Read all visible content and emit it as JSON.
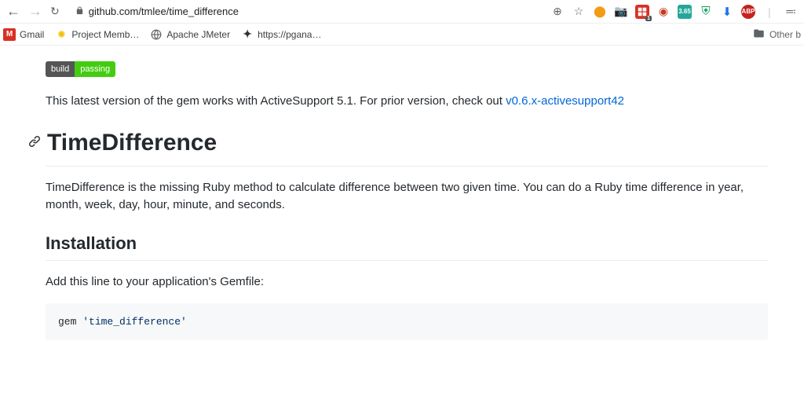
{
  "browser": {
    "url": "github.com/tmlee/time_difference",
    "extensions": {
      "red1_text": "1",
      "teal_text": "3.65",
      "abp_text": "ABP"
    }
  },
  "bookmarks": {
    "gmail": "Gmail",
    "project": "Project Memb…",
    "apache": "Apache JMeter",
    "pgana": "https://pgana…",
    "other": "Other b"
  },
  "badge": {
    "label": "build",
    "status": "passing"
  },
  "readme": {
    "intro_prefix": "This latest version of the gem works with ActiveSupport 5.1. For prior version, check out ",
    "intro_link": "v0.6.x-activesupport42",
    "h1": "TimeDifference",
    "description": "TimeDifference is the missing Ruby method to calculate difference between two given time. You can do a Ruby time difference in year, month, week, day, hour, minute, and seconds.",
    "h2": "Installation",
    "install_text": "Add this line to your application's Gemfile:",
    "code_gem": "gem ",
    "code_str": "'time_difference'"
  }
}
